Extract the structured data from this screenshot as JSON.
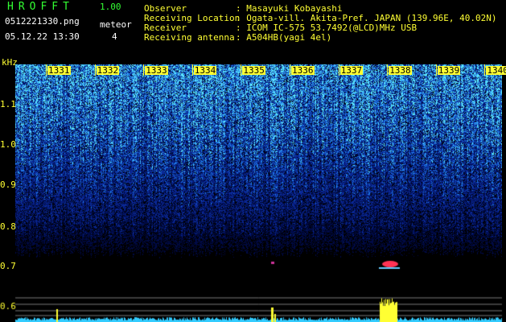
{
  "header": {
    "app_title": "HROFFT",
    "app_version": "1.00",
    "filename": "0512221330.png",
    "datetime": "05.12.22 13:30",
    "detection_label": "meteor",
    "detection_count": "4"
  },
  "station": {
    "observer_label": "Observer",
    "observer_value": ": Masayuki Kobayashi",
    "location_label": "Receiving Location",
    "location_value": ": Ogata-vill. Akita-Pref. JAPAN (139.96E, 40.02N)",
    "receiver_label": "Receiver",
    "receiver_value": ": ICOM IC-575 53.7492(@LCD)MHz USB",
    "antenna_label": "Receiving antenna",
    "antenna_value": ": A504HB(yagi 4el)"
  },
  "axes": {
    "y_unit": "kHz",
    "y_ticks": [
      "1.1",
      "1.0",
      "0.9",
      "0.8",
      "0.7",
      "0.6"
    ],
    "x_ticks": [
      "1331",
      "1332",
      "1333",
      "1334",
      "1335",
      "1336",
      "1337",
      "1338",
      "1339",
      "1340"
    ]
  },
  "colors": {
    "title_green": "#33ff33",
    "label_yellow": "#ffff33",
    "echo_red": "#ff3355"
  }
}
